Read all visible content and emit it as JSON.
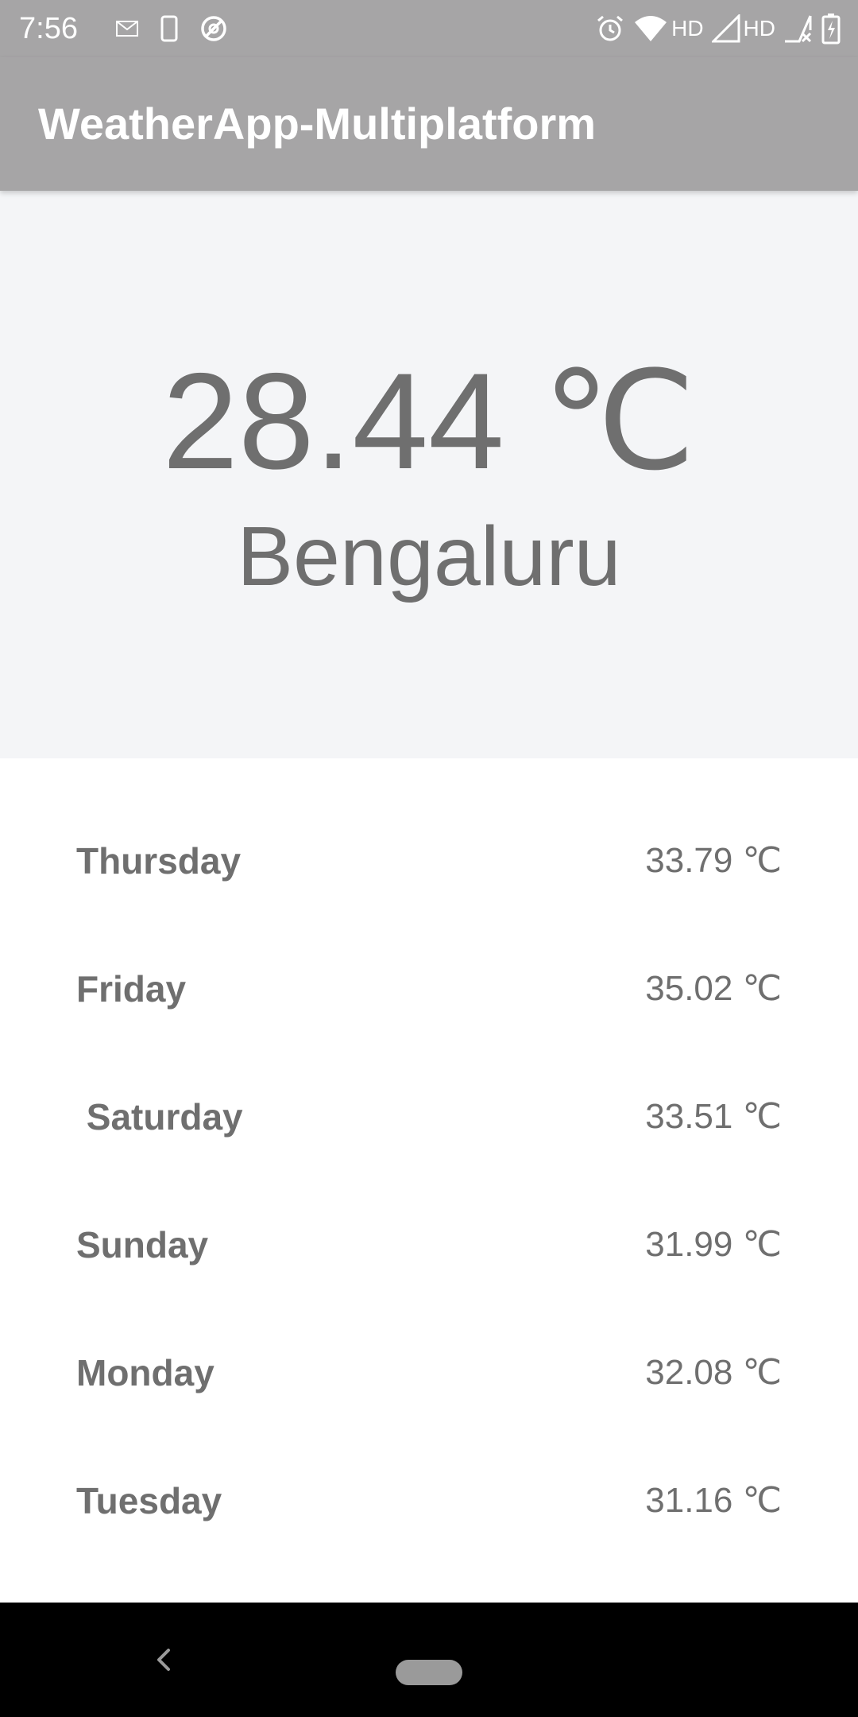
{
  "status_bar": {
    "time": "7:56",
    "left_icons": [
      "gmail-icon",
      "phone-outline-icon",
      "no-disturb-icon"
    ],
    "right_icons": [
      "alarm-icon",
      "wifi-icon",
      "signal-icon",
      "signal-x-icon",
      "battery-charging-icon"
    ],
    "hd_label_1": "HD",
    "hd_label_2": "HD"
  },
  "app_bar": {
    "title": "WeatherApp-Multiplatform"
  },
  "current": {
    "temperature": "28.44 ℃",
    "city": "Bengaluru"
  },
  "forecast": [
    {
      "day": "Thursday",
      "temp": "33.79 ℃"
    },
    {
      "day": "Friday",
      "temp": "35.02 ℃"
    },
    {
      "day": " Saturday",
      "temp": "33.51 ℃"
    },
    {
      "day": "Sunday",
      "temp": "31.99 ℃"
    },
    {
      "day": "Monday",
      "temp": "32.08 ℃"
    },
    {
      "day": "Tuesday",
      "temp": "31.16 ℃"
    }
  ],
  "nav_bar": {
    "icons": [
      "back-icon",
      "home-pill-icon"
    ]
  },
  "colors": {
    "app_bar": "#a6a5a6",
    "hero_bg": "#f4f5f7",
    "text": "#6f6f6f",
    "nav_bar": "#000000"
  }
}
